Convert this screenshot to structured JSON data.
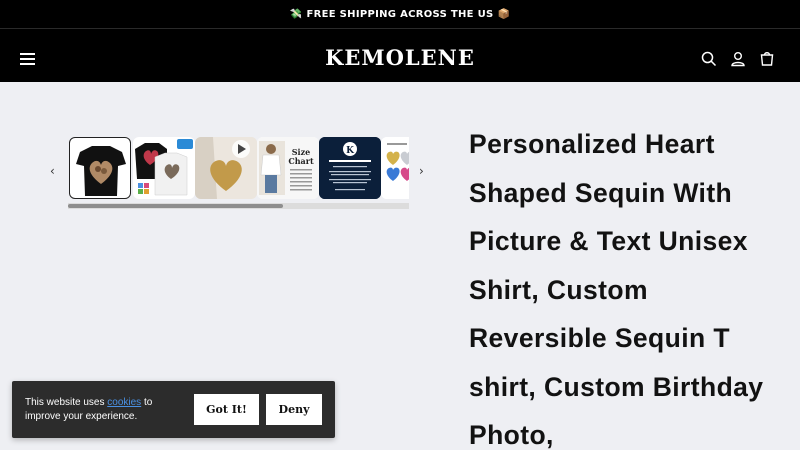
{
  "announcement": {
    "text": "FREE SHIPPING ACROSS THE US",
    "left_emoji": "💸",
    "right_emoji": "📦"
  },
  "header": {
    "logo": "KEMOLENE",
    "icons": [
      "menu-icon",
      "search-icon",
      "account-icon",
      "cart-icon"
    ]
  },
  "gallery": {
    "thumbnails": [
      "Black shirt with heart photo",
      "Black and white shirts with hearts",
      "Video: heart sequin on shirt",
      "Size chart",
      "All items made to order",
      "Heart sequin color options"
    ]
  },
  "product": {
    "title": "Personalized Heart Shaped Sequin With Picture & Text Unisex Shirt, Custom Reversible Sequin T shirt, Custom Birthday Photo,"
  },
  "cookie_banner": {
    "text_before": "This website uses ",
    "link": "cookies",
    "text_after": " to improve your experience.",
    "accept": "Got It!",
    "deny": "Deny"
  },
  "colors": {
    "bar": "#000000",
    "page_bg": "#eeeff3",
    "link": "#4a90e2",
    "banner": "#2c2c2c"
  }
}
